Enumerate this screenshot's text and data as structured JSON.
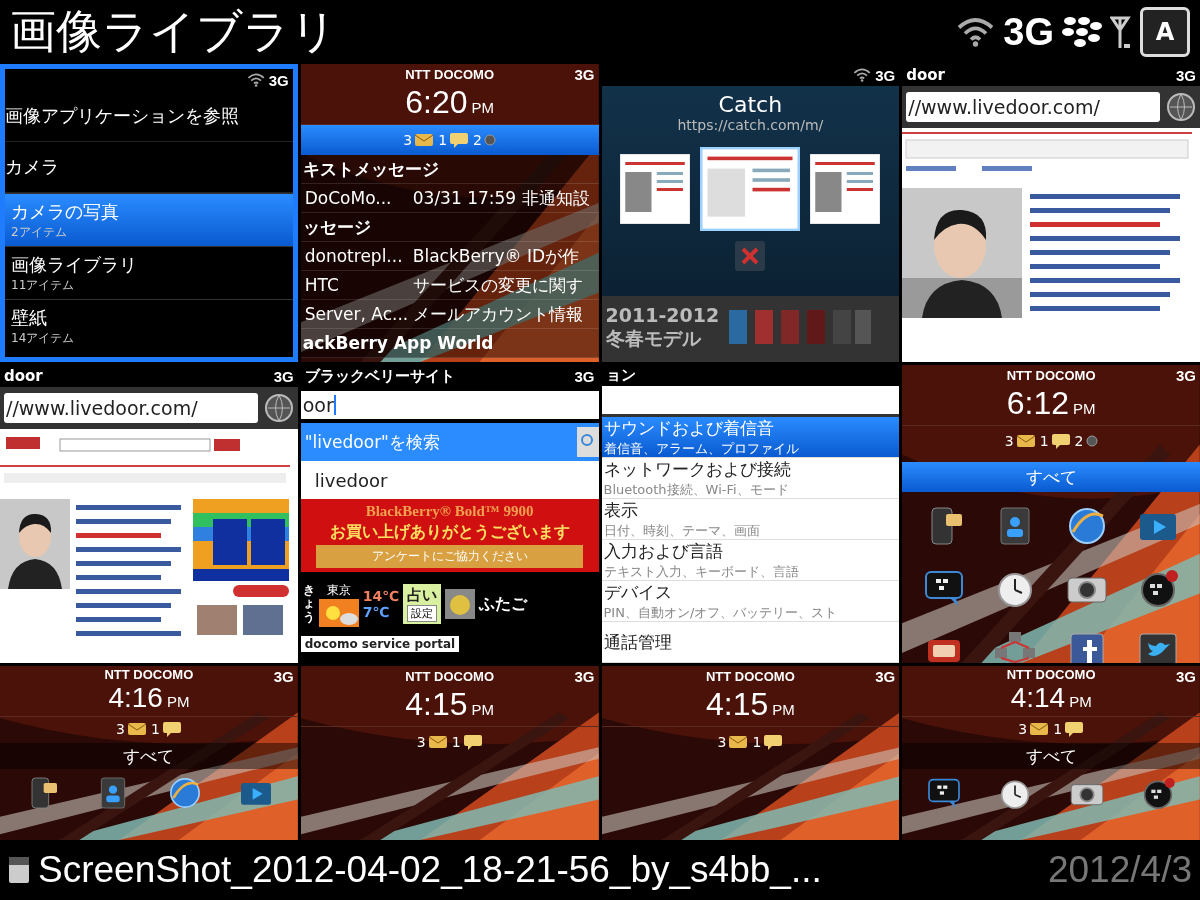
{
  "header": {
    "title": "画像ライブラリ",
    "network": "3G",
    "key": "A"
  },
  "tiles": [
    {
      "kind": "menu",
      "selected": true,
      "network": "3G",
      "headings": [
        "画像アプリケーションを参照",
        "カメラ"
      ],
      "items": [
        {
          "title": "カメラの写真",
          "subtitle": "2アイテム",
          "selected": true
        },
        {
          "title": "画像ライブラリ",
          "subtitle": "11アイテム",
          "selected": false
        },
        {
          "title": "壁紙",
          "subtitle": "14アイテム",
          "selected": false
        }
      ]
    },
    {
      "kind": "home",
      "selected": false,
      "carrier": "NTT DOCOMO",
      "network": "3G",
      "time": "6:20",
      "ampm": "PM",
      "counts_selected": true,
      "counts": [
        {
          "count": "3",
          "kind": "mail"
        },
        {
          "count": "1",
          "kind": "chat"
        },
        {
          "count": "2",
          "kind": "bbm"
        }
      ],
      "messages": [
        {
          "kind": "section",
          "text": "キストメッセージ"
        },
        {
          "kind": "row",
          "from": "DoCoMo...",
          "text": "03/31 17:59 非通知設"
        },
        {
          "kind": "section",
          "text": "ッセージ"
        },
        {
          "kind": "row",
          "from": "donotrepl...",
          "text": "BlackBerry® IDが作"
        },
        {
          "kind": "row",
          "from": "HTC",
          "text": "サービスの変更に関す"
        },
        {
          "kind": "row",
          "from": "Server, Ac...",
          "text": "メールアカウント情報"
        },
        {
          "kind": "section",
          "text": "ackBerry App World"
        }
      ]
    },
    {
      "kind": "switcher",
      "selected": false,
      "network": "3G",
      "app": "Catch",
      "url": "https://catch.com/m/",
      "banner": [
        "2011-2012",
        "冬春モデル"
      ]
    },
    {
      "kind": "browser",
      "selected": false,
      "title": "door",
      "network": "3G",
      "url": "//www.livedoor.com/",
      "page": {
        "kind": "article"
      }
    },
    {
      "kind": "browser",
      "selected": false,
      "title": "door",
      "network": "3G",
      "url": "//www.livedoor.com/",
      "page": {
        "kind": "portal"
      }
    },
    {
      "kind": "search",
      "selected": false,
      "title": "ブラックベリーサイト",
      "network": "3G",
      "query": "oor",
      "suggestion": "\"livedoor\"を検索",
      "history": "livedoor",
      "ad_title": "BlackBerry® Bold™ 9900",
      "ad_text": "お買い上げありがとうございます",
      "ad_button": "アンケートにご協力ください",
      "today": "きょう",
      "city": "東京",
      "high": "14℃",
      "low": "7℃",
      "fortune": "占い",
      "fortune_button": "設定",
      "sign": "ふたご",
      "portal": "docomo service portal"
    },
    {
      "kind": "options",
      "selected": false,
      "title": "ョン",
      "items": [
        {
          "title": "サウンドおよび着信音",
          "subtitle": "着信音、アラーム、プロファイル",
          "selected": true
        },
        {
          "title": "ネットワークおよび接続",
          "subtitle": "Bluetooth接続、Wi-Fi、モード",
          "selected": false
        },
        {
          "title": "表示",
          "subtitle": "日付、時刻、テーマ、画面",
          "selected": false
        },
        {
          "title": "入力および言語",
          "subtitle": "テキスト入力、キーボード、言語",
          "selected": false
        },
        {
          "title": "デバイス",
          "subtitle": "PIN、自動オン/オフ、バッテリー、スト",
          "selected": false
        },
        {
          "title": "通話管理",
          "selected": false
        }
      ]
    },
    {
      "kind": "home",
      "selected": false,
      "carrier": "NTT DOCOMO",
      "network": "3G",
      "time": "6:12",
      "ampm": "PM",
      "counts_selected": false,
      "counts": [
        {
          "count": "3",
          "kind": "mail"
        },
        {
          "count": "1",
          "kind": "chat"
        },
        {
          "count": "2",
          "kind": "bbm"
        }
      ],
      "filter": "すべて",
      "filter_selected": true,
      "apps": {
        "kind": "grid"
      }
    },
    {
      "kind": "home",
      "selected": false,
      "carrier": "NTT DOCOMO",
      "network": "3G",
      "time": "4:16",
      "ampm": "PM",
      "counts_selected": false,
      "counts": [
        {
          "count": "3",
          "kind": "mail"
        },
        {
          "count": "1",
          "kind": "chat"
        }
      ],
      "filter": "すべて",
      "filter_selected": false,
      "apps": {
        "kind": "dock"
      }
    },
    {
      "kind": "home",
      "selected": false,
      "carrier": "NTT DOCOMO",
      "network": "3G",
      "time": "4:15",
      "ampm": "PM",
      "counts_selected": false,
      "counts": [
        {
          "count": "3",
          "kind": "mail"
        },
        {
          "count": "1",
          "kind": "chat"
        }
      ]
    },
    {
      "kind": "home",
      "selected": false,
      "carrier": "NTT DOCOMO",
      "network": "3G",
      "time": "4:15",
      "ampm": "PM",
      "counts_selected": false,
      "counts": [
        {
          "count": "3",
          "kind": "mail"
        },
        {
          "count": "1",
          "kind": "chat"
        }
      ]
    },
    {
      "kind": "home",
      "selected": false,
      "carrier": "NTT DOCOMO",
      "network": "3G",
      "time": "4:14",
      "ampm": "PM",
      "counts_selected": false,
      "counts": [
        {
          "count": "3",
          "kind": "mail"
        },
        {
          "count": "1",
          "kind": "chat"
        }
      ],
      "filter": "すべて",
      "filter_selected": false,
      "apps": {
        "kind": "dock2"
      }
    }
  ],
  "footer": {
    "filename": "ScreenShot_2012-04-02_18-21-56_by_s4bb_...",
    "date": "2012/4/3"
  }
}
